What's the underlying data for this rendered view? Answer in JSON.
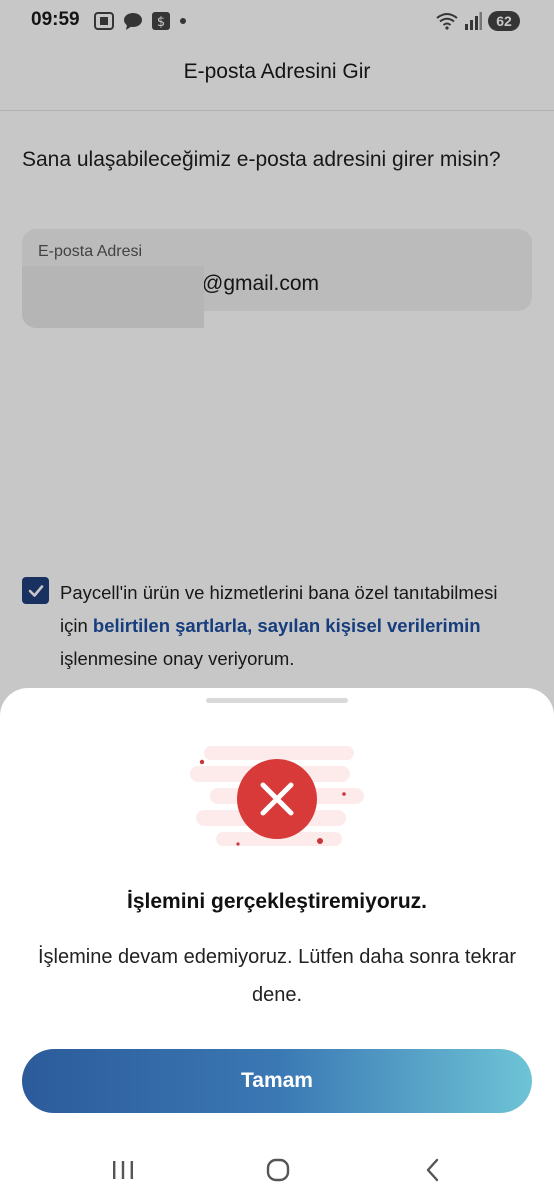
{
  "status_bar": {
    "time": "09:59",
    "battery": "62",
    "icons": [
      "screenshot-icon",
      "chat-bubble-icon",
      "dollar-app-icon",
      "dot-icon",
      "wifi-icon",
      "signal-icon"
    ]
  },
  "header": {
    "title": "E-posta Adresini Gir"
  },
  "form": {
    "prompt": "Sana ulaşabileceğimiz e-posta adresini girer misin?",
    "email_label": "E-posta Adresi",
    "email_value": "@gmail.com"
  },
  "consent": {
    "checked": true,
    "text_before": "Paycell'in ürün ve hizmetlerini bana özel tanıtabilmesi için ",
    "link_text": "belirtilen şartlarla, sayılan kişisel verilerimin",
    "text_after": " işlenmesine onay veriyorum."
  },
  "dialog": {
    "title": "İşlemini gerçekleştiremiyoruz.",
    "message": "İşlemine devam edemiyoruz. Lütfen daha sonra tekrar dene.",
    "button_label": "Tamam",
    "icon": "error-x-icon"
  },
  "navigation_bar": {
    "items": [
      "recent-apps-icon",
      "home-icon",
      "back-icon"
    ]
  },
  "colors": {
    "primary_blue": "#1f3f7c",
    "link_blue": "#1d4fa0",
    "error_red": "#d83a3a",
    "button_gradient_start": "#2c5b9a",
    "button_gradient_end": "#6ec4d6"
  }
}
